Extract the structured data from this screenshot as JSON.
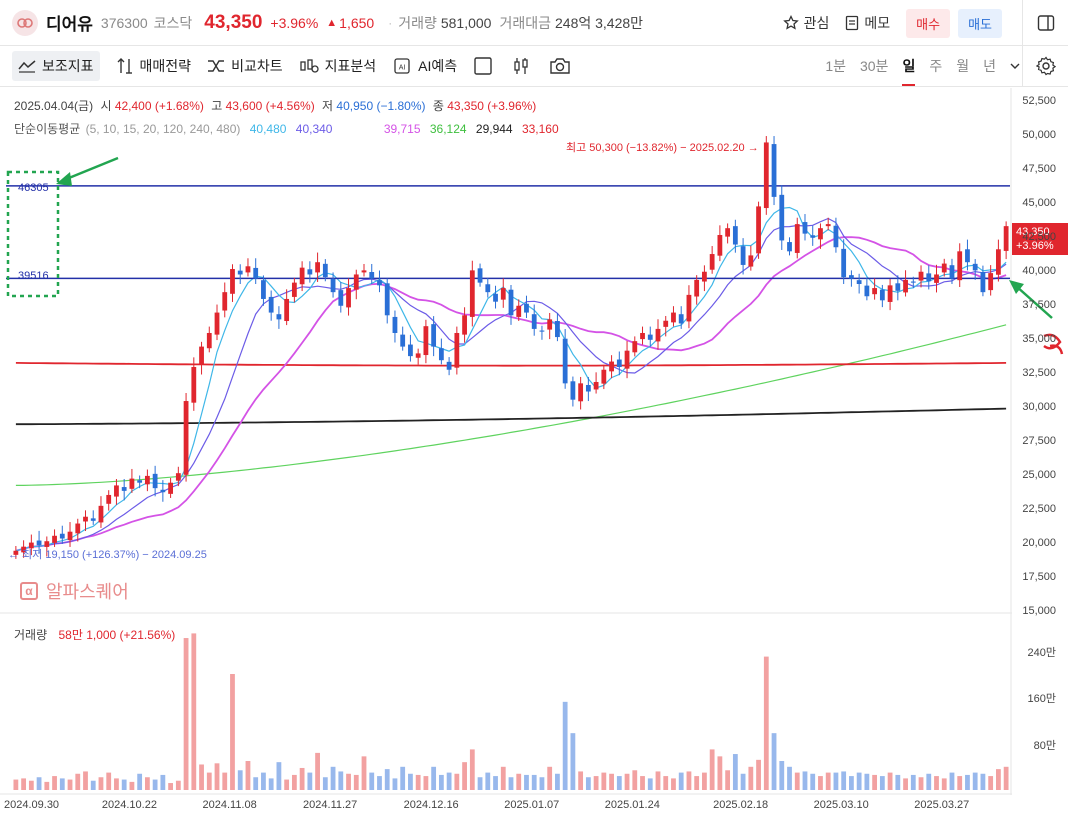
{
  "header": {
    "name": "디어유",
    "code": "376300",
    "market": "코스닥",
    "price": "43,350",
    "change_pct": "+3.96%",
    "change_amt": "1,650",
    "volume_label": "거래량",
    "volume": "581,000",
    "turnover_label": "거래대금",
    "turnover": "248억 3,428만",
    "watch_label": "관심",
    "memo_label": "메모",
    "buy_label": "매수",
    "sell_label": "매도"
  },
  "toolbar": {
    "items": [
      "보조지표",
      "매매전략",
      "비교차트",
      "지표분석",
      "AI예측"
    ],
    "periods": [
      "1분",
      "30분",
      "일",
      "주",
      "월",
      "년"
    ],
    "active_period": "일"
  },
  "info": {
    "date": "2025.04.04(금)",
    "open_label": "시",
    "open": "42,400 (+1.68%)",
    "high_label": "고",
    "high": "43,600 (+4.56%)",
    "low_label": "저",
    "low": "40,950 (−1.80%)",
    "close_label": "종",
    "close": "43,350 (+3.96%)",
    "ma_label": "단순이동평균",
    "ma_periods": "(5, 10, 15, 20, 120, 240, 480)",
    "ma_values": [
      "40,480",
      "40,340",
      "39,715",
      "36,124",
      "29,944",
      "33,160"
    ],
    "ma_colors": [
      "#3fb7e8",
      "#6c5ce7",
      "#d453e6",
      "#3fbf3f",
      "#222222",
      "#e0262e"
    ],
    "high_annotation": "최고 50,300 (−13.82%) − 2025.02.20 →",
    "low_annotation": "← 최저 19,150 (+126.37%) − 2024.09.25",
    "hline1": "46305",
    "hline2": "39516",
    "watermark": "알파스퀘어",
    "volume_label": "거래량",
    "volume_value": "58만 1,000 (+21.56%)",
    "price_tag": "43,350",
    "price_tag_pct": "+3.96%"
  },
  "y_axis": [
    "52,500",
    "50,000",
    "47,500",
    "45,000",
    "42,500",
    "40,000",
    "37,500",
    "35,000",
    "32,500",
    "30,000",
    "27,500",
    "25,000",
    "22,500",
    "20,000",
    "17,500",
    "15,000"
  ],
  "vol_axis": [
    "240만",
    "160만",
    "80만"
  ],
  "x_axis": [
    "2024.09.30",
    "2024.10.22",
    "2024.11.08",
    "2024.11.27",
    "2024.12.16",
    "2025.01.07",
    "2025.01.24",
    "2025.02.18",
    "2025.03.10",
    "2025.03.27"
  ],
  "colors": {
    "up": "#e0262e",
    "down": "#2a6fd6",
    "hline": "#2330a8",
    "annot_green": "#22a550"
  },
  "chart_data": {
    "type": "candlestick",
    "closes": [
      19500,
      19800,
      20100,
      19900,
      20200,
      20600,
      20400,
      20900,
      21500,
      22000,
      21700,
      22800,
      23600,
      24300,
      23900,
      24800,
      24500,
      25000,
      24100,
      23800,
      24500,
      25200,
      30500,
      33000,
      34500,
      35500,
      37000,
      38500,
      40200,
      39800,
      40400,
      39500,
      38000,
      37000,
      36500,
      38000,
      39200,
      40300,
      39800,
      40700,
      39600,
      38500,
      37500,
      38800,
      39800,
      40100,
      39500,
      39000,
      36800,
      35500,
      34500,
      33800,
      34000,
      36000,
      34500,
      33500,
      32800,
      35500,
      36800,
      40100,
      39200,
      38500,
      37800,
      38800,
      36800,
      37500,
      37000,
      35800,
      35600,
      36500,
      35200,
      31800,
      30600,
      31800,
      31200,
      31900,
      32800,
      33400,
      33000,
      34200,
      34900,
      35500,
      35000,
      35800,
      36400,
      37000,
      36200,
      38300,
      39400,
      40000,
      41300,
      42700,
      43200,
      42000,
      40500,
      41200,
      44800,
      49500,
      45500,
      42300,
      41500,
      43500,
      42800,
      42500,
      43200,
      43500,
      41800,
      39600,
      39500,
      39100,
      38200,
      38800,
      37900,
      39000,
      38600,
      39400,
      39200,
      40000,
      39300,
      39800,
      40600,
      39500,
      41500,
      40700,
      40100,
      38500,
      39900,
      41650,
      43350
    ],
    "ma": {
      "ma5_ma10": "shown as lines",
      "ma120": "29,944",
      "ma240": "33,160"
    },
    "volumes": [
      18,
      20,
      16,
      22,
      14,
      24,
      20,
      18,
      28,
      32,
      16,
      22,
      30,
      20,
      18,
      14,
      28,
      22,
      18,
      26,
      12,
      16,
      262,
      270,
      44,
      30,
      46,
      30,
      200,
      34,
      50,
      22,
      30,
      20,
      48,
      18,
      26,
      38,
      30,
      64,
      22,
      40,
      32,
      28,
      26,
      58,
      30,
      24,
      36,
      20,
      40,
      28,
      26,
      24,
      40,
      26,
      30,
      28,
      48,
      70,
      22,
      30,
      24,
      40,
      22,
      28,
      26,
      26,
      22,
      40,
      28,
      152,
      98,
      32,
      22,
      24,
      30,
      28,
      24,
      28,
      34,
      24,
      20,
      32,
      24,
      20,
      30,
      32,
      24,
      30,
      70,
      58,
      34,
      62,
      28,
      40,
      52,
      230,
      98,
      50,
      40,
      30,
      32,
      28,
      24,
      30,
      30,
      32,
      24,
      30,
      28,
      26,
      24,
      30,
      26,
      20,
      26,
      22,
      28,
      24,
      20,
      30,
      24,
      26,
      30,
      28,
      24,
      36,
      40
    ],
    "hlines": [
      46305,
      39516
    ]
  }
}
